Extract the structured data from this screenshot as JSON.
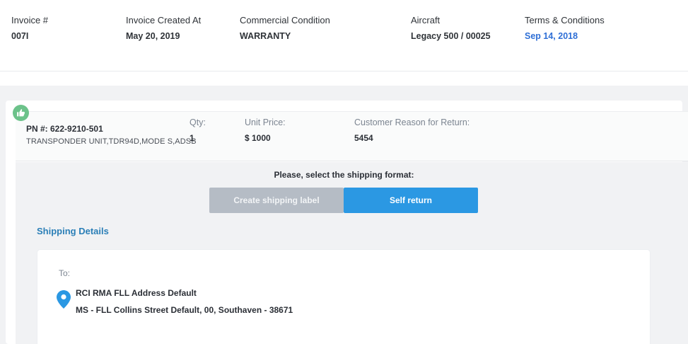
{
  "header": {
    "invoice_label": "Invoice #",
    "invoice_value": "007I",
    "created_label": "Invoice Created At",
    "created_value": "May 20, 2019",
    "condition_label": "Commercial Condition",
    "condition_value": "WARRANTY",
    "aircraft_label": "Aircraft",
    "aircraft_value": "Legacy 500 / 00025",
    "terms_label": "Terms & Conditions",
    "terms_value": "Sep 14, 2018"
  },
  "item": {
    "status_icon": "thumbs-up-icon",
    "pn": "PN #: 622-9210-501",
    "description": "TRANSPONDER UNIT,TDR94D,MODE S,ADSB",
    "qty_label": "Qty:",
    "qty_value": "1",
    "price_label": "Unit Price:",
    "price_value": "$ 1000",
    "reason_label": "Customer Reason for Return:",
    "reason_value": "5454"
  },
  "shipping": {
    "prompt": "Please, select the shipping format:",
    "create_label_button": "Create shipping label",
    "self_return_button": "Self return",
    "details_title": "Shipping Details",
    "to_label": "To:",
    "address_name": "RCI RMA FLL Address Default",
    "address_line": "MS - FLL Collins Street Default, 00, Southaven - 38671",
    "pin_icon": "location-pin-icon"
  },
  "colors": {
    "accent_blue": "#2b98e3",
    "link_blue": "#2f6fd6",
    "title_blue": "#2b7fb7",
    "success_green": "#6cc28a",
    "disabled_grey": "#b5bcc5"
  }
}
